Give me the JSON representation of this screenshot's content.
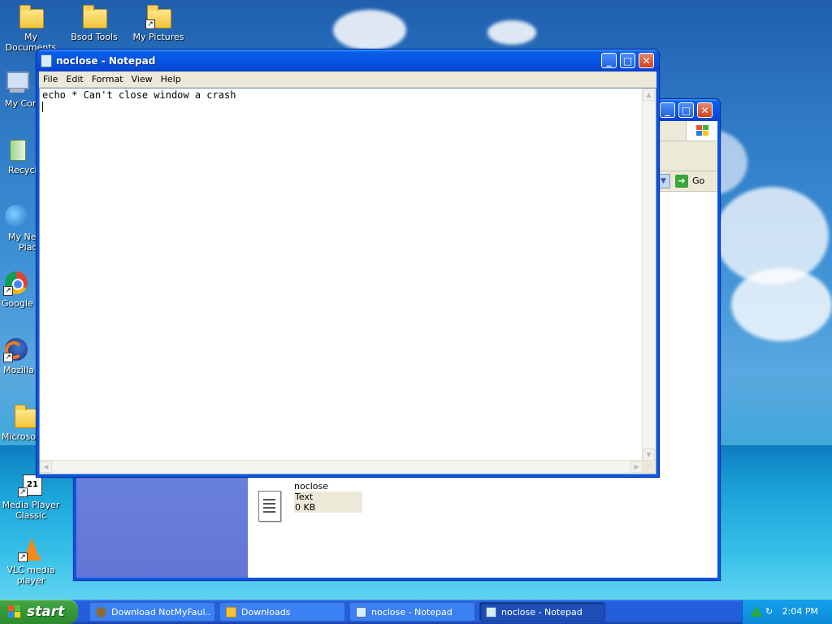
{
  "desktop": {
    "icons": [
      {
        "label": "My Documents"
      },
      {
        "label": "Bsod Tools"
      },
      {
        "label": "My Pictures"
      },
      {
        "label": "My Com"
      },
      {
        "label": "Recycle"
      },
      {
        "label": "My Net"
      },
      {
        "label": "Place"
      },
      {
        "label": "Google C"
      },
      {
        "label": "Mozilla F"
      },
      {
        "label": "Microsof"
      },
      {
        "label": "Media Player"
      },
      {
        "label": "Classic"
      },
      {
        "label": "VLC media"
      },
      {
        "label": "player"
      }
    ]
  },
  "explorer": {
    "go_label": "Go",
    "file": {
      "name": "noclose",
      "type": "Text Document",
      "size": "0 KB"
    }
  },
  "notepad": {
    "title": "noclose - Notepad",
    "menu": [
      "File",
      "Edit",
      "Format",
      "View",
      "Help"
    ],
    "content": "echo * Can't close window a crash"
  },
  "taskbar": {
    "start_label": "start",
    "tasks": [
      {
        "label": "Download NotMyFaul..."
      },
      {
        "label": "Downloads"
      },
      {
        "label": "noclose - Notepad"
      },
      {
        "label": "noclose - Notepad"
      }
    ],
    "clock": "2:04 PM"
  },
  "colors": {
    "xp_blue": "#0554e3",
    "start_green": "#379a37",
    "tray_blue": "#0b8ad8"
  }
}
